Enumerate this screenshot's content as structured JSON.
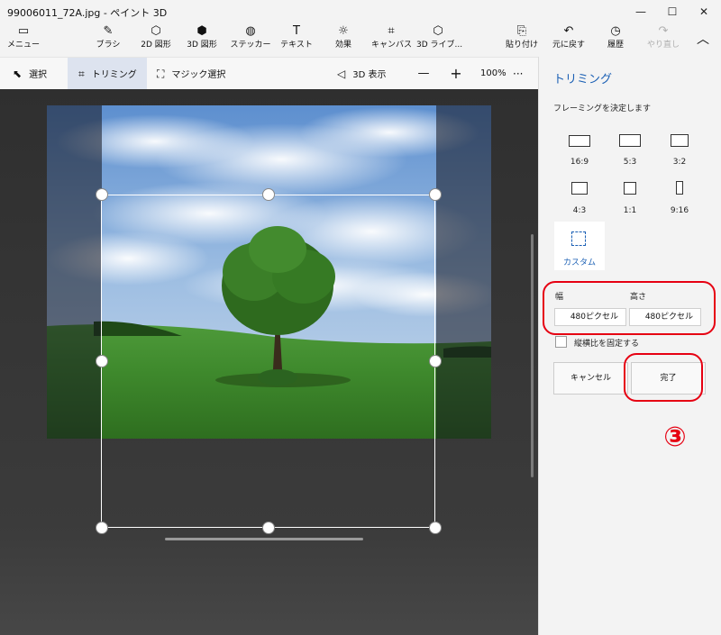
{
  "window": {
    "title": "99006011_72A.jpg - ペイント 3D",
    "controls": [
      "—",
      "☐",
      "✕"
    ]
  },
  "ribbon": {
    "menu": {
      "label": "メニュー",
      "icon": "folder-icon"
    },
    "tools": [
      {
        "label": "ブラシ",
        "icon": "brush-icon",
        "glyph": "✎"
      },
      {
        "label": "2D 図形",
        "icon": "2d-shapes-icon",
        "glyph": "⬡"
      },
      {
        "label": "3D 図形",
        "icon": "3d-shapes-icon",
        "glyph": "⬢"
      },
      {
        "label": "ステッカー",
        "icon": "sticker-icon",
        "glyph": "◍"
      },
      {
        "label": "テキスト",
        "icon": "text-icon",
        "glyph": "T"
      },
      {
        "label": "効果",
        "icon": "effects-icon",
        "glyph": "☼"
      },
      {
        "label": "キャンバス",
        "icon": "canvas-icon",
        "glyph": "⌗"
      },
      {
        "label": "3D ライブ...",
        "icon": "3d-library-icon",
        "glyph": "⬡"
      }
    ],
    "actions": [
      {
        "label": "貼り付け",
        "icon": "paste-icon",
        "glyph": "⎘"
      },
      {
        "label": "元に戻す",
        "icon": "undo-icon",
        "glyph": "↶"
      },
      {
        "label": "履歴",
        "icon": "history-icon",
        "glyph": "◷"
      },
      {
        "label": "やり直し",
        "icon": "redo-icon",
        "glyph": "↷"
      }
    ],
    "collapse_glyph": "︿"
  },
  "toolbar": {
    "select": {
      "label": "選択",
      "glyph": "⬉"
    },
    "crop": {
      "label": "トリミング",
      "glyph": "⌗"
    },
    "magic_select": {
      "label": "マジック選択",
      "glyph": "⛶"
    },
    "view3d": {
      "label": "3D 表示",
      "glyph": "◁"
    },
    "zoom_out": "—",
    "zoom_in": "+",
    "zoom": "100%",
    "more": "···"
  },
  "panel": {
    "title": "トリミング",
    "framing_label": "フレーミングを決定します",
    "ratios": [
      "16:9",
      "5:3",
      "3:2",
      "4:3",
      "1:1",
      "9:16"
    ],
    "custom_label": "カスタム",
    "width_label": "幅",
    "height_label": "高さ",
    "width_value": "480ピクセル",
    "height_value": "480ピクセル",
    "lock_label": "縦横比を固定する",
    "cancel_label": "キャンセル",
    "done_label": "完了"
  },
  "annotation": {
    "step_number": "③",
    "color": "#e60012"
  },
  "colors": {
    "accent": "#1a5fb4",
    "canvas": "#3a3a3a",
    "annotation": "#e60012"
  }
}
